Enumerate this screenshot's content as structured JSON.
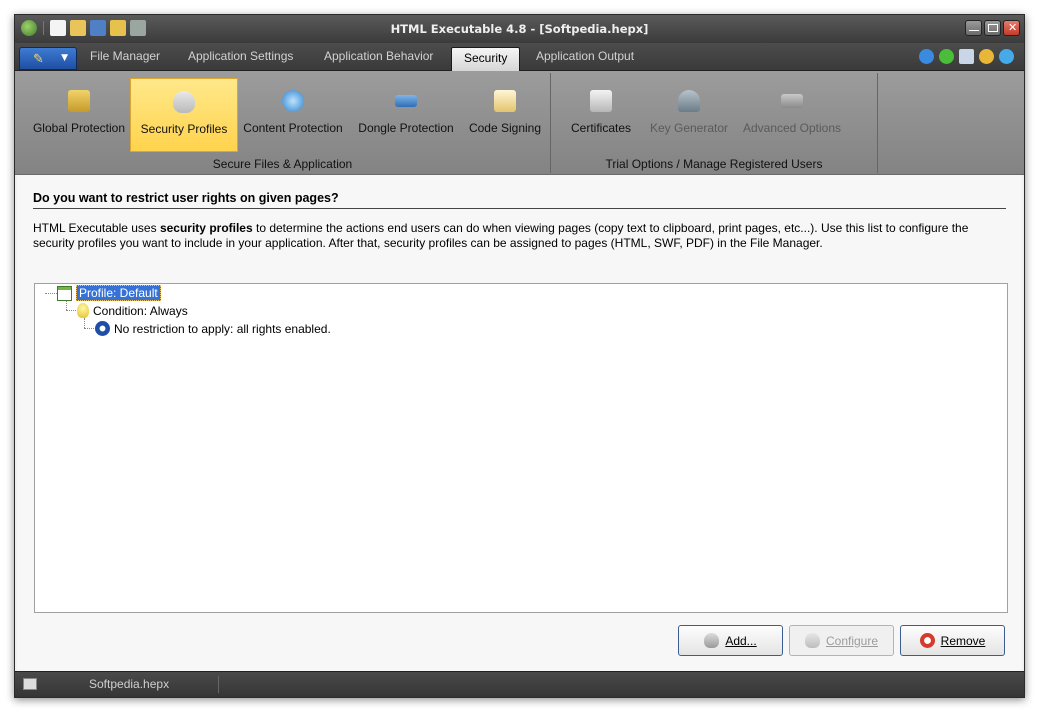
{
  "window": {
    "title": "HTML Executable 4.8 - [Softpedia.hepx]"
  },
  "tabs": [
    "File Manager",
    "Application Settings",
    "Application Behavior",
    "Security",
    "Application Output"
  ],
  "ribbon": {
    "groups": [
      {
        "label": "Secure Files & Application",
        "buttons": [
          "Global Protection",
          "Security Profiles",
          "Content Protection",
          "Dongle Protection",
          "Code Signing"
        ]
      },
      {
        "label": "Trial Options / Manage Registered Users",
        "buttons": [
          "Certificates",
          "Key Generator",
          "Advanced Options"
        ]
      }
    ]
  },
  "content": {
    "heading": "Do you want to restrict user rights on given pages?",
    "desc_before": "HTML Executable uses ",
    "desc_bold": "security profiles",
    "desc_after": " to determine the actions end users can do when viewing pages (copy text to clipboard, print pages, etc...). Use this list to configure the security profiles you want to include in your application. After that, security profiles can be assigned to pages (HTML, SWF, PDF) in the File Manager."
  },
  "tree": {
    "profile": "Profile: Default",
    "condition": "Condition: Always",
    "restriction": "No restriction to apply: all rights enabled."
  },
  "buttons": {
    "add": "Add...",
    "configure": "Configure",
    "remove": "Remove"
  },
  "status": {
    "filename": "Softpedia.hepx"
  },
  "colors": {
    "ribbon_selected": "#ffd34d",
    "tab_active": "#e6e6e6",
    "selection": "#3672d6"
  }
}
